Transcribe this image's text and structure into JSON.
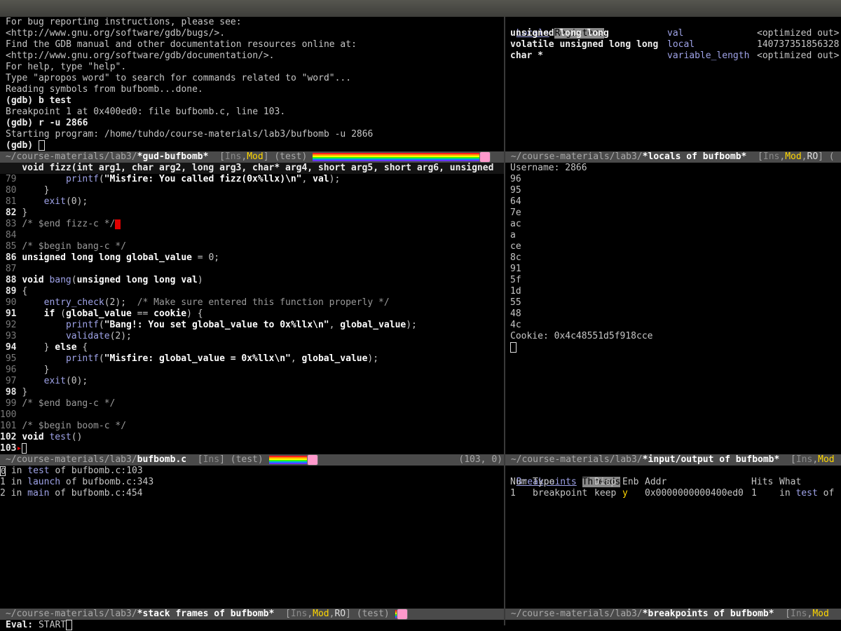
{
  "gdb": {
    "lines": [
      "For bug reporting instructions, please see:",
      "<http://www.gnu.org/software/gdb/bugs/>.",
      "Find the GDB manual and other documentation resources online at:",
      "<http://www.gnu.org/software/gdb/documentation/>.",
      "For help, type \"help\".",
      "Type \"apropos word\" to search for commands related to \"word\"...",
      "Reading symbols from bufbomb...done."
    ],
    "cmd1": "(gdb) b test",
    "bp_msg": "Breakpoint 1 at 0x400ed0: file bufbomb.c, line 103.",
    "cmd2": "(gdb) r -u 2866",
    "starting": "Starting program: /home/tuhdo/course-materials/lab3/bufbomb -u 2866",
    "prompt": "(gdb) "
  },
  "modelines": {
    "gud": {
      "dir": " ~/course-materials/lab3/",
      "name": "*gud-bufbomb*",
      "pre": "  [",
      "ins": "Ins",
      "comma": ",",
      "mod": "Mod",
      "post": "] (test) "
    },
    "locals": {
      "dir": " ~/course-materials/lab3/",
      "name": "*locals of bufbomb*",
      "pre": "  [",
      "ins": "Ins",
      "comma1": ",",
      "mod": "Mod",
      "comma2": ",",
      "ro": "RO",
      "post": "] ("
    },
    "source": {
      "dir": " ~/course-materials/lab3/",
      "name": "bufbomb.c",
      "pre": "  [",
      "ins": "Ins",
      "post": "] (test) ",
      "pos": "(103, 0)"
    },
    "io": {
      "dir": " ~/course-materials/lab3/",
      "name": "*input/output of bufbomb*",
      "pre": "  [",
      "ins": "Ins",
      "comma": ",",
      "mod": "Mod"
    },
    "stack": {
      "dir": " ~/course-materials/lab3/",
      "name": "*stack frames of bufbomb*",
      "pre": "  [",
      "ins": "Ins",
      "comma1": ",",
      "mod": "Mod",
      "comma2": ",",
      "ro": "RO",
      "post": "] (test) "
    },
    "breakpoints": {
      "dir": " ~/course-materials/lab3/",
      "name": "*breakpoints of bufbomb*",
      "pre": "  [",
      "ins": "Ins",
      "comma": ",",
      "mod": "Mod"
    }
  },
  "locals_tabs": {
    "active": "Locals",
    "other": "Registers"
  },
  "locals": [
    {
      "type": "unsigned long long",
      "name": "val",
      "value": "<optimized out>"
    },
    {
      "type": "volatile unsigned long long",
      "name": "local",
      "value": "140737351856328"
    },
    {
      "type": "char *",
      "name": "variable_length",
      "value": "<optimized out>"
    }
  ],
  "source": {
    "header": "    void fizz(int arg1, char arg2, long arg3, char* arg4, short arg5, short arg6, unsigned",
    "lines": [
      {
        "n": "79",
        "code": "        printf(\"Misfire: You called fizz(0x%llx)\\n\", val);"
      },
      {
        "n": "80",
        "code": "    }"
      },
      {
        "n": "81",
        "code": "    exit(0);"
      },
      {
        "n": "82",
        "code": "}"
      },
      {
        "n": "83",
        "code": "/* $end fizz-c */"
      },
      {
        "n": "84",
        "code": ""
      },
      {
        "n": "85",
        "code": "/* $begin bang-c */"
      },
      {
        "n": "86",
        "code": "unsigned long long global_value = 0;"
      },
      {
        "n": "87",
        "code": ""
      },
      {
        "n": "88",
        "code": "void bang(unsigned long long val)"
      },
      {
        "n": "89",
        "code": "{"
      },
      {
        "n": "90",
        "code": "    entry_check(2);  /* Make sure entered this function properly */"
      },
      {
        "n": "91",
        "code": "    if (global_value == cookie) {"
      },
      {
        "n": "92",
        "code": "        printf(\"Bang!: You set global_value to 0x%llx\\n\", global_value);"
      },
      {
        "n": "93",
        "code": "        validate(2);"
      },
      {
        "n": "94",
        "code": "    } else {"
      },
      {
        "n": "95",
        "code": "        printf(\"Misfire: global_value = 0x%llx\\n\", global_value);"
      },
      {
        "n": "96",
        "code": "    }"
      },
      {
        "n": "97",
        "code": "    exit(0);"
      },
      {
        "n": "98",
        "code": "}"
      },
      {
        "n": "99",
        "code": "/* $end bang-c */"
      },
      {
        "n": "100",
        "code": ""
      },
      {
        "n": "101",
        "code": "/* $begin boom-c */"
      },
      {
        "n": "102",
        "code": "void test()"
      },
      {
        "n": "103",
        "code": "{"
      }
    ]
  },
  "io_output": {
    "username": "Username: 2866",
    "bytes": [
      "96",
      "95",
      "64",
      "7e",
      "ac",
      "a",
      "ce",
      "8c",
      "91",
      "5f",
      "1d",
      "55",
      "48",
      "4c"
    ],
    "cookie": "Cookie: 0x4c48551d5f918cce"
  },
  "stack_frames": [
    {
      "idx": "0",
      "in": " in ",
      "fn": "test",
      "of": " of bufbomb.c:103"
    },
    {
      "idx": "1",
      "in": " in ",
      "fn": "launch",
      "of": " of bufbomb.c:343"
    },
    {
      "idx": "2",
      "in": " in ",
      "fn": "main",
      "of": " of bufbomb.c:454"
    }
  ],
  "bp_tabs": {
    "active": "Breakpoints",
    "other": "Threads"
  },
  "breakpoints": {
    "headers": {
      "num": "Num",
      "type": "Type",
      "disp": "Disp",
      "enb": "Enb",
      "addr": "Addr",
      "hits": "Hits",
      "what": "What"
    },
    "row": {
      "num": "1",
      "type": "breakpoint",
      "disp": "keep",
      "enb": "y",
      "addr": "0x0000000000400ed0",
      "hits": "1",
      "in": "in",
      "fn": "test",
      "of": "of"
    }
  },
  "minibuffer": {
    "label": "Eval:",
    "text": " START"
  }
}
